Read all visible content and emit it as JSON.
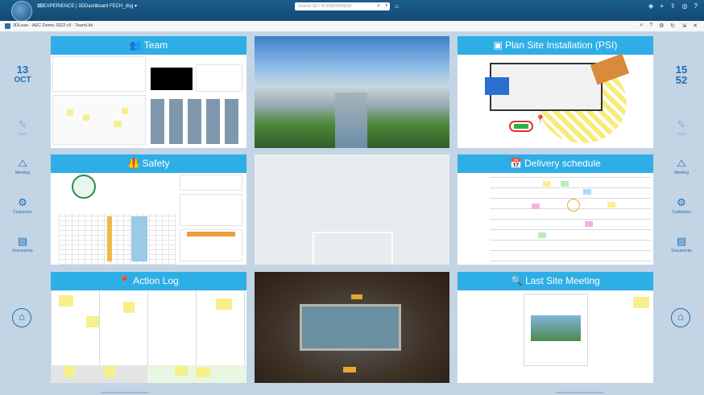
{
  "topbar": {
    "brand_prefix": "3D",
    "brand_text": "EXPERIENCE | 3DDashboard",
    "brand_suffix": "FECH_dsg",
    "search_placeholder": "Search GET N°/2DB/4008000"
  },
  "tab": {
    "title": "3DLean - AEC Demo 2022 v3 - TeamLife"
  },
  "left_panel": {
    "date_day": "13",
    "date_month": "OCT",
    "items": [
      {
        "label": "Tools",
        "icon": "edit-icon"
      },
      {
        "label": "Meeting",
        "icon": "meeting-icon"
      },
      {
        "label": "Customize",
        "icon": "gear-icon"
      },
      {
        "label": "Documents",
        "icon": "document-icon"
      }
    ]
  },
  "right_panel": {
    "time_hour": "15",
    "time_minute": "52",
    "items": [
      {
        "label": "Tools",
        "icon": "edit-icon"
      },
      {
        "label": "Meeting",
        "icon": "meeting-icon"
      },
      {
        "label": "Customize",
        "icon": "gear-icon"
      },
      {
        "label": "Documents",
        "icon": "document-icon"
      }
    ]
  },
  "tiles": {
    "team": {
      "title": "Team",
      "icon": "team-icon"
    },
    "psi": {
      "title": "Plan Site Installation (PSI)",
      "icon": "box-icon"
    },
    "safety": {
      "title": "Safety",
      "icon": "safety-vest-icon"
    },
    "delivery": {
      "title": "Delivery schedule",
      "icon": "calendar-icon"
    },
    "action": {
      "title": "Action Log",
      "icon": "pin-icon"
    },
    "meeting": {
      "title": "Last Site Meeting",
      "icon": "magnifier-icon"
    }
  },
  "colors": {
    "header_blue": "#2eaee6",
    "accent_blue": "#1a6fb2",
    "canvas_bg": "#c3d4e5"
  }
}
